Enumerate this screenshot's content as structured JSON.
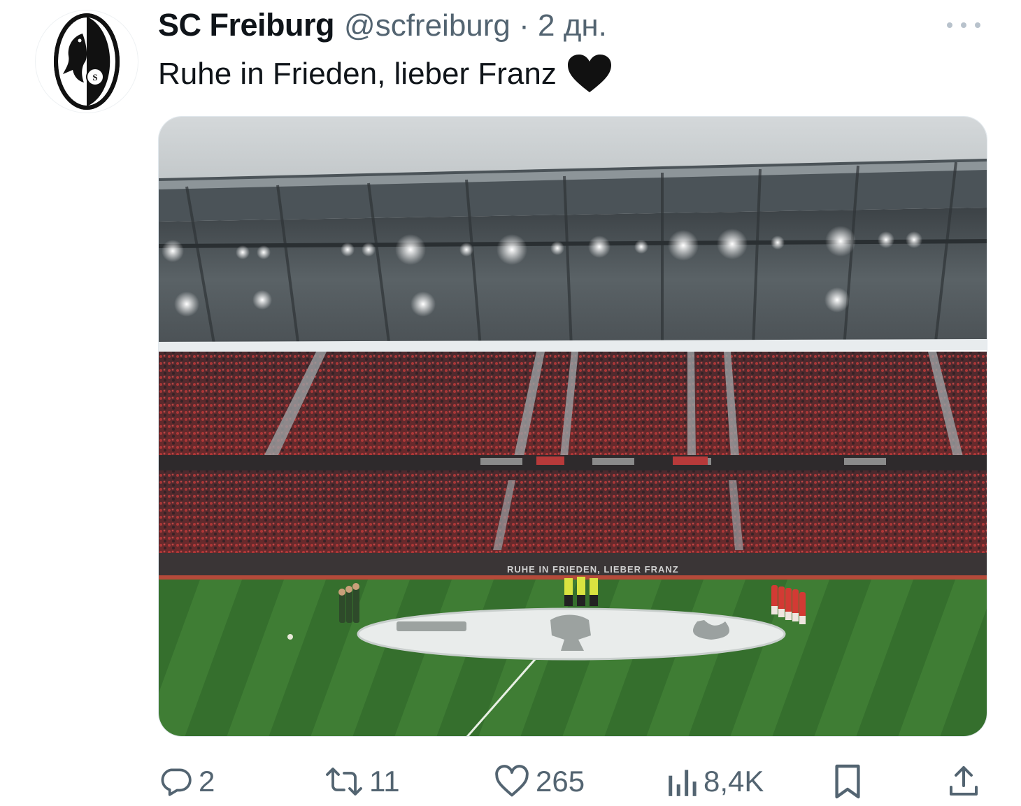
{
  "author": {
    "display_name": "SC Freiburg",
    "handle": "@scfreiburg",
    "separator": "·",
    "time_ago": "2 дн."
  },
  "tweet": {
    "text": "Ruhe in Frieden, lieber Franz",
    "emoji": "black-heart"
  },
  "media": {
    "banner_text": "RUHE IN FRIEDEN, LIEBER FRANZ",
    "description_kind": "stadium-photo"
  },
  "actions": {
    "replies": "2",
    "retweets": "11",
    "likes": "265",
    "views": "8,4K"
  },
  "colors": {
    "text_primary": "#0f1419",
    "text_secondary": "#536471",
    "pitch_green": "#3d7a2e",
    "crowd_red": "#8a2a2a"
  }
}
